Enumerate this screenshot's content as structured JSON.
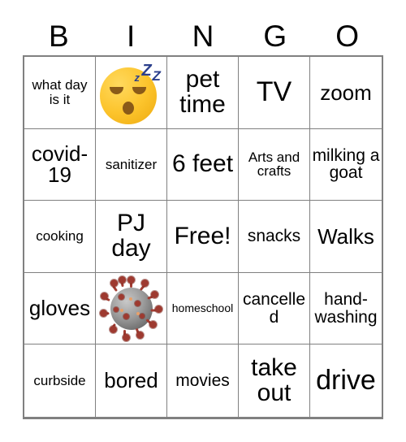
{
  "card": {
    "header_letters": [
      "B",
      "I",
      "N",
      "G",
      "O"
    ],
    "cells": [
      {
        "text": "what day is it",
        "size": "sm",
        "type": "text"
      },
      {
        "text": "",
        "size": "sm",
        "type": "emoji-sleeping-face"
      },
      {
        "text": "pet time",
        "size": "xl",
        "type": "text"
      },
      {
        "text": "TV",
        "size": "xxl",
        "type": "text"
      },
      {
        "text": "zoom",
        "size": "lg",
        "type": "text"
      },
      {
        "text": "covid-19",
        "size": "lg",
        "type": "text"
      },
      {
        "text": "sanitizer",
        "size": "sm",
        "type": "text"
      },
      {
        "text": "6 feet",
        "size": "xl",
        "type": "text"
      },
      {
        "text": "Arts and crafts",
        "size": "sm",
        "type": "text"
      },
      {
        "text": "milking a goat",
        "size": "md",
        "type": "text"
      },
      {
        "text": "cooking",
        "size": "sm",
        "type": "text"
      },
      {
        "text": "PJ day",
        "size": "xl",
        "type": "text"
      },
      {
        "text": "Free!",
        "size": "xl",
        "type": "text"
      },
      {
        "text": "snacks",
        "size": "md",
        "type": "text"
      },
      {
        "text": "Walks",
        "size": "lg",
        "type": "text"
      },
      {
        "text": "gloves",
        "size": "lg",
        "type": "text"
      },
      {
        "text": "",
        "size": "sm",
        "type": "image-coronavirus"
      },
      {
        "text": "homeschool",
        "size": "xs",
        "type": "text"
      },
      {
        "text": "cancelled",
        "size": "md",
        "type": "text"
      },
      {
        "text": "hand-washing",
        "size": "md",
        "type": "text"
      },
      {
        "text": "curbside",
        "size": "sm",
        "type": "text"
      },
      {
        "text": "bored",
        "size": "lg",
        "type": "text"
      },
      {
        "text": "movies",
        "size": "md",
        "type": "text"
      },
      {
        "text": "take out",
        "size": "xl",
        "type": "text"
      },
      {
        "text": "drive",
        "size": "xxl",
        "type": "text"
      }
    ],
    "emoji": {
      "sleeping_face": {
        "name": "sleeping-face-emoji",
        "z_letters": [
          "z",
          "Z",
          "Z"
        ]
      }
    },
    "image": {
      "coronavirus": {
        "name": "coronavirus-illustration"
      }
    },
    "colors": {
      "grid_border": "#808080",
      "text": "#000000",
      "background": "#ffffff",
      "emoji_face": "#fcc42c",
      "emoji_z": "#2b3f8c",
      "virus_body": "#8c8c8c",
      "virus_spike": "#9e3a30"
    }
  }
}
